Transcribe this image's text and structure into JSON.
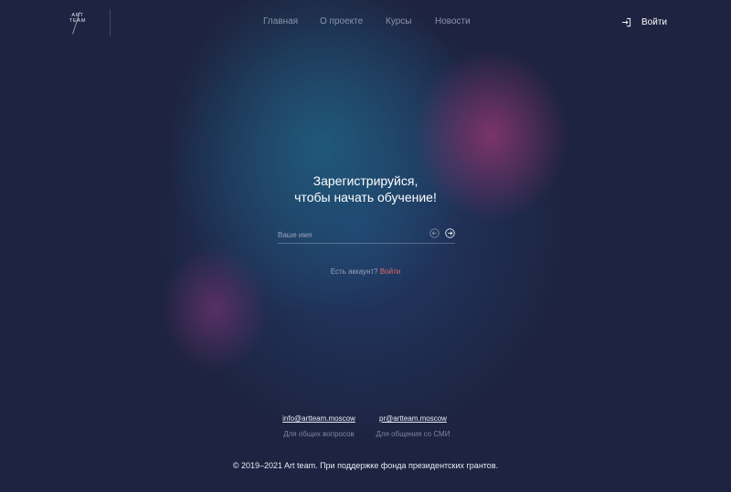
{
  "logo": {
    "line1": "ART",
    "line2": "TEAM"
  },
  "nav": {
    "items": [
      {
        "label": "Главная"
      },
      {
        "label": "О проекте"
      },
      {
        "label": "Курсы"
      },
      {
        "label": "Новости"
      }
    ]
  },
  "header": {
    "login_label": "Войти",
    "login_icon": "login-icon"
  },
  "hero": {
    "title_line1": "Зарегистрируйся,",
    "title_line2": "чтобы начать обучение!"
  },
  "form": {
    "name_placeholder": "Ваше имя",
    "name_value": "",
    "back_icon": "arrow-left-circle-icon",
    "next_icon": "arrow-right-circle-icon"
  },
  "account": {
    "question": "Есть аккаунт?",
    "login_link": "Войти"
  },
  "contacts": [
    {
      "email": "info@artteam.moscow",
      "description": "Для общих вопросов"
    },
    {
      "email": "pr@artteam.moscow",
      "description": "Для общения со СМИ"
    }
  ],
  "footer": {
    "copyright": "© 2019–2021 Art team. При поддержке фонда президентских грантов."
  },
  "colors": {
    "background": "#1d2340",
    "accent_link": "#e46a6a",
    "nav_text": "#8c93ad"
  }
}
